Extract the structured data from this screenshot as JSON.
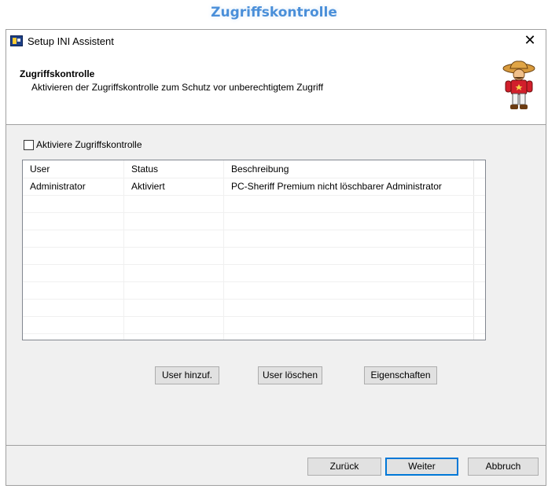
{
  "page_heading": "Zugriffskontrolle",
  "window": {
    "title": "Setup INI Assistent",
    "close_glyph": "✕"
  },
  "header": {
    "title": "Zugriffskontrolle",
    "subtitle": "Aktivieren der Zugriffskontrolle zum Schutz vor unberechtigtem Zugriff"
  },
  "access_control": {
    "checkbox_label": "Aktiviere Zugriffskontrolle",
    "checked": false
  },
  "table": {
    "columns": [
      "User",
      "Status",
      "Beschreibung"
    ],
    "rows": [
      [
        "Administrator",
        "Aktiviert",
        "PC-Sheriff Premium nicht löschbarer Administrator"
      ]
    ]
  },
  "buttons": {
    "add_user": "User hinzuf.",
    "delete_user": "User löschen",
    "properties": "Eigenschaften",
    "back": "Zurück",
    "next": "Weiter",
    "cancel": "Abbruch"
  },
  "icons": {
    "app": "setup-app-icon",
    "mascot": "sheriff-mascot-icon",
    "close": "close-icon"
  },
  "colors": {
    "heading": "#4a8fd9",
    "dialog_background": "#f0f0f0",
    "default_button_border": "#0078d7"
  }
}
